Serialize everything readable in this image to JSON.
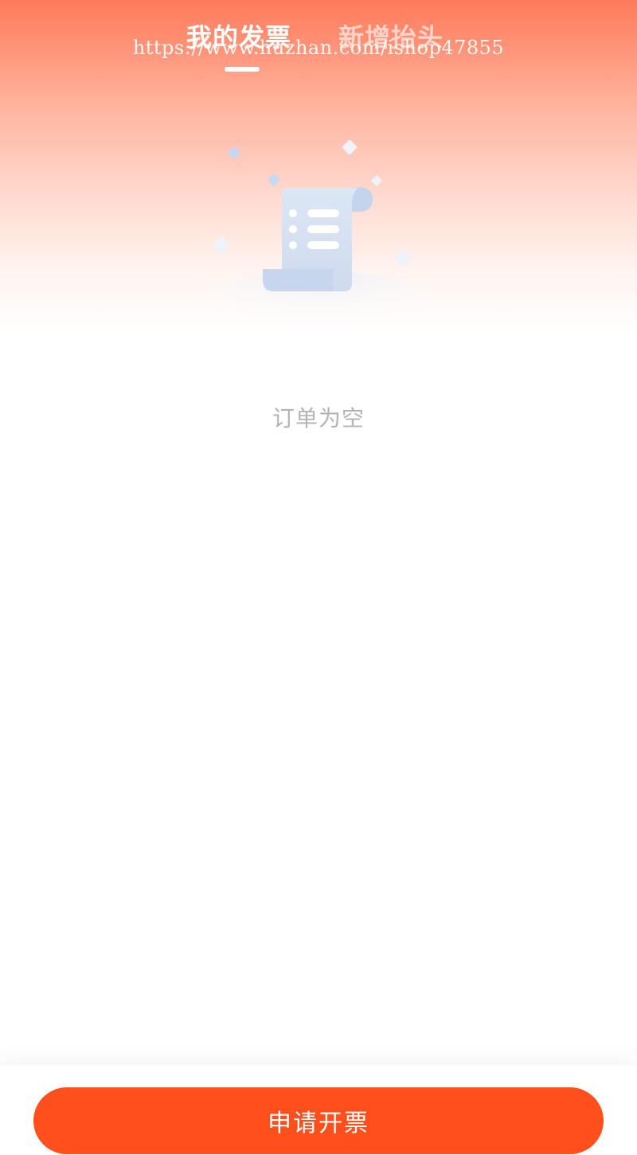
{
  "tabs": [
    {
      "label": "我的发票",
      "active": true
    },
    {
      "label": "新增抬头",
      "active": false
    }
  ],
  "watermark": "https://www.huzhan.com/ishop47855",
  "empty_state": {
    "message": "订单为空",
    "icon": "empty-document-icon"
  },
  "footer": {
    "apply_label": "申请开票"
  },
  "colors": {
    "primary": "#ff4f1c",
    "header_top": "#ff7a5c",
    "empty_text": "#b3b3b3",
    "illustration": "#d6e2f3"
  }
}
